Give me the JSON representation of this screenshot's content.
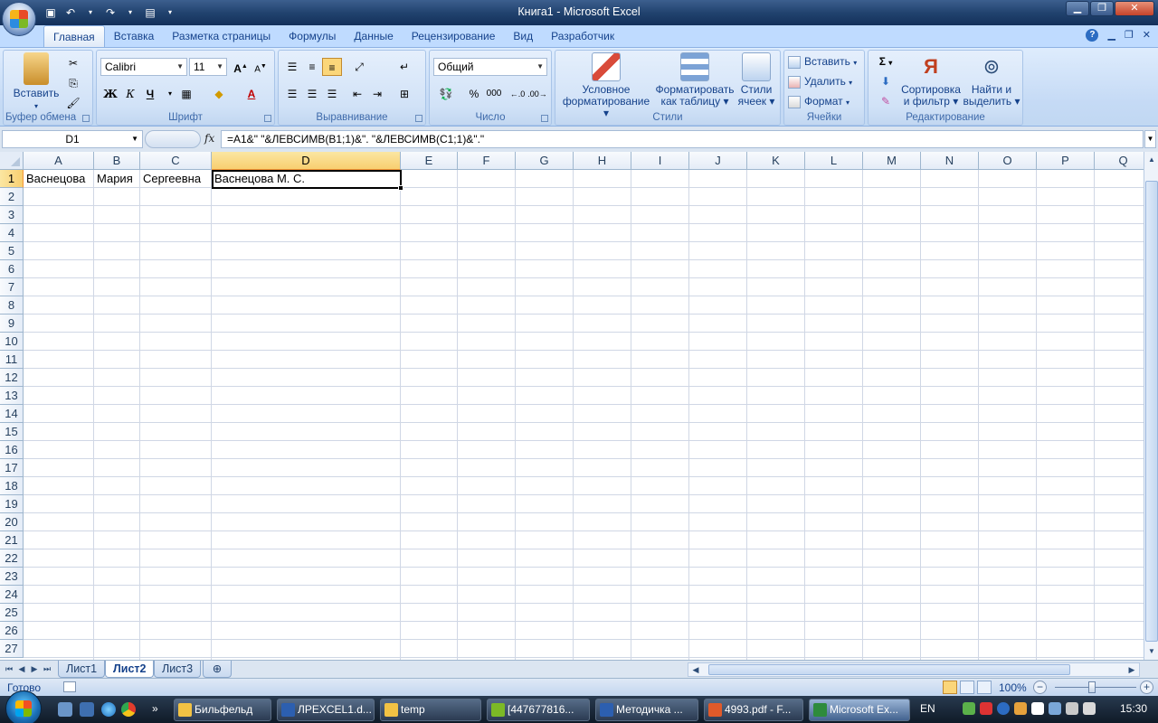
{
  "window": {
    "title": "Книга1 - Microsoft Excel"
  },
  "qat": {
    "save_icon": "save-icon",
    "undo_icon": "undo-icon",
    "redo_icon": "redo-icon"
  },
  "tabs": [
    {
      "label": "Главная",
      "active": true
    },
    {
      "label": "Вставка"
    },
    {
      "label": "Разметка страницы"
    },
    {
      "label": "Формулы"
    },
    {
      "label": "Данные"
    },
    {
      "label": "Рецензирование"
    },
    {
      "label": "Вид"
    },
    {
      "label": "Разработчик"
    }
  ],
  "ribbon": {
    "clipboard": {
      "label": "Буфер обмена",
      "paste": "Вставить"
    },
    "font": {
      "label": "Шрифт",
      "name": "Calibri",
      "size": "11",
      "bold": "Ж",
      "italic": "К",
      "underline": "Ч",
      "grow": "A",
      "shrink": "A",
      "color_glyph": "A"
    },
    "alignment": {
      "label": "Выравнивание"
    },
    "number": {
      "label": "Число",
      "format": "Общий",
      "percent": "%",
      "thousands": "000"
    },
    "styles": {
      "label": "Стили",
      "conditional_1": "Условное",
      "conditional_2": "форматирование",
      "table_1": "Форматировать",
      "table_2": "как таблицу",
      "cell_1": "Стили",
      "cell_2": "ячеек"
    },
    "cells": {
      "label": "Ячейки",
      "insert": "Вставить",
      "delete": "Удалить",
      "format": "Формат"
    },
    "editing": {
      "label": "Редактирование",
      "sum": "Σ",
      "sort_1": "Сортировка",
      "sort_2": "и фильтр",
      "find_1": "Найти и",
      "find_2": "выделить"
    }
  },
  "formula_bar": {
    "name_box": "D1",
    "fx": "fx",
    "formula": "=A1&\" \"&ЛЕВСИМВ(B1;1)&\". \"&ЛЕВСИМВ(C1;1)&\".\""
  },
  "grid": {
    "columns": [
      "A",
      "B",
      "C",
      "D",
      "E",
      "F",
      "G",
      "H",
      "I",
      "J",
      "K",
      "L",
      "M",
      "N",
      "O",
      "P",
      "Q"
    ],
    "rows": [
      "1",
      "2",
      "3",
      "4",
      "5",
      "6",
      "7",
      "8",
      "9",
      "10",
      "11",
      "12",
      "13",
      "14",
      "15",
      "16",
      "17",
      "18",
      "19",
      "20",
      "21",
      "22",
      "23",
      "24",
      "25",
      "26",
      "27"
    ],
    "selected_column": "D",
    "selected_row": "1",
    "cells": {
      "A1": "Васнецова",
      "B1": "Мария",
      "C1": "Сергеевна",
      "D1": "Васнецова М. С."
    }
  },
  "sheets": [
    {
      "label": "Лист1"
    },
    {
      "label": "Лист2",
      "active": true
    },
    {
      "label": "Лист3"
    }
  ],
  "status": {
    "text": "Готово",
    "zoom": "100%"
  },
  "taskbar": {
    "items": [
      {
        "label": "Бильфельд"
      },
      {
        "label": "ЛРEXCEL1.d..."
      },
      {
        "label": "temp"
      },
      {
        "label": "[447677816..."
      },
      {
        "label": "Методичка ..."
      },
      {
        "label": "4993.pdf - F..."
      },
      {
        "label": "Microsoft Ex...",
        "active": true
      }
    ],
    "lang": "EN",
    "time": "15:30"
  },
  "colors": {
    "accent": "#15428b",
    "ribbon_bg": "#c5daf5",
    "selected_header": "#f8cf70",
    "taskbar": "#1a2a3d"
  }
}
